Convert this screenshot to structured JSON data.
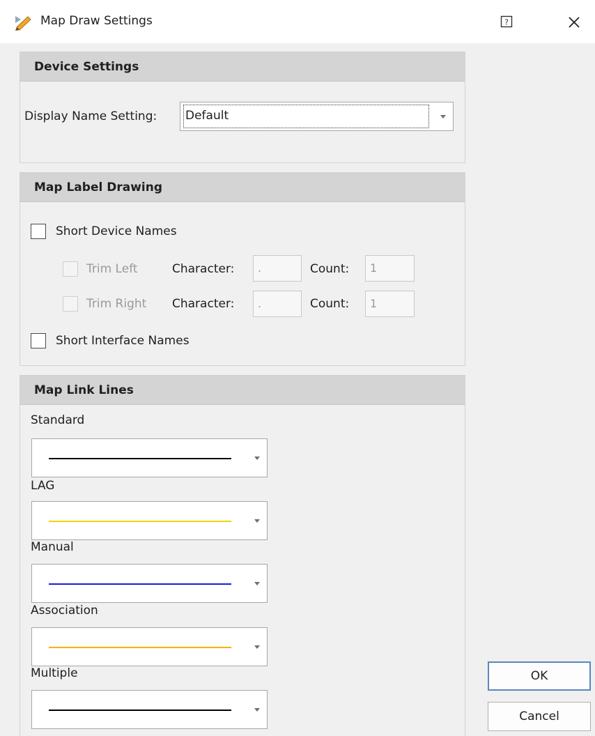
{
  "window": {
    "title": "Map Draw Settings"
  },
  "device_settings": {
    "header": "Device Settings",
    "display_name_label": "Display Name Setting:",
    "display_name_value": "Default"
  },
  "map_label_drawing": {
    "header": "Map Label Drawing",
    "short_device_names": {
      "label": "Short Device Names",
      "checked": false
    },
    "trim_left": {
      "label": "Trim Left",
      "character_label": "Character:",
      "character_value": ".",
      "count_label": "Count:",
      "count_value": "1"
    },
    "trim_right": {
      "label": "Trim Right",
      "character_label": "Character:",
      "character_value": ".",
      "count_label": "Count:",
      "count_value": "1"
    },
    "short_interface_names": {
      "label": "Short Interface Names",
      "checked": false
    }
  },
  "map_link_lines": {
    "header": "Map Link Lines",
    "lines": [
      {
        "label": "Standard",
        "color": "#000000"
      },
      {
        "label": "LAG",
        "color": "#f2d20c"
      },
      {
        "label": "Manual",
        "color": "#1a1adc"
      },
      {
        "label": "Association",
        "color": "#f5b400"
      },
      {
        "label": "Multiple",
        "color": "#000000"
      }
    ]
  },
  "buttons": {
    "ok": "OK",
    "cancel": "Cancel"
  },
  "icons": {
    "app": "pen-map-icon",
    "help": "help-icon",
    "close": "close-icon"
  }
}
